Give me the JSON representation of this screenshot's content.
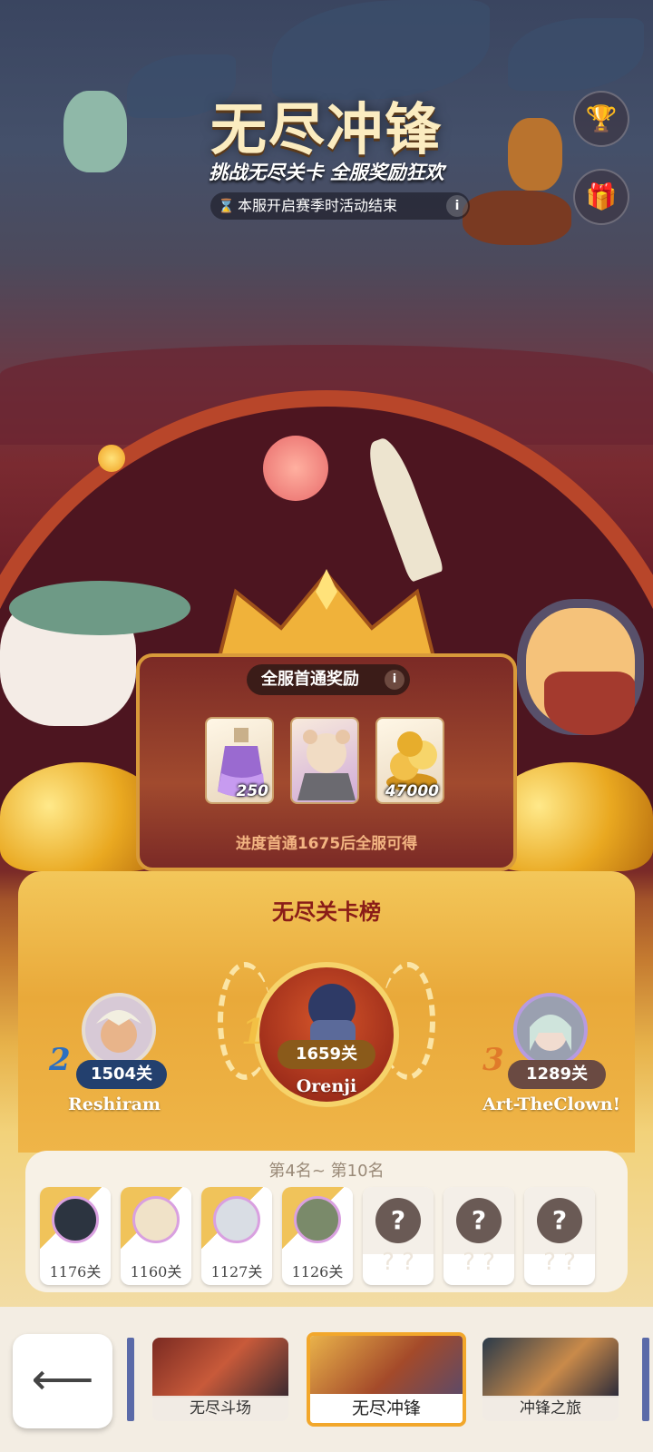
{
  "header": {
    "title": "无尽冲锋",
    "subtitle": "挑战无尽关卡 全服奖励狂欢",
    "season_note": "本服开启赛季时活动结束",
    "info_icon": "i"
  },
  "side_buttons": [
    {
      "name": "trophy-icon",
      "glyph": "🏆"
    },
    {
      "name": "gift-icon",
      "glyph": "🎁"
    }
  ],
  "first_clear": {
    "title": "全服首通奖励",
    "info_icon": "i",
    "rewards": [
      {
        "item": "purple-potion",
        "amount": "250"
      },
      {
        "item": "hamster-avatar",
        "amount": ""
      },
      {
        "item": "gold-coins",
        "amount": "47000"
      }
    ],
    "unlock_text": "进度首通1675后全服可得"
  },
  "leaderboard": {
    "title": "无尽关卡榜",
    "top3": [
      {
        "rank": "1",
        "score": "1659关",
        "name": "Orenji"
      },
      {
        "rank": "2",
        "score": "1504关",
        "name": "Reshiram"
      },
      {
        "rank": "3",
        "score": "1289关",
        "name": "Art-TheClown!"
      }
    ],
    "lower_title": "第4名~ 第10名",
    "lower": [
      {
        "score": "1176关",
        "locked": false
      },
      {
        "score": "1160关",
        "locked": false
      },
      {
        "score": "1127关",
        "locked": false
      },
      {
        "score": "1126关",
        "locked": false
      },
      {
        "score": "",
        "locked": true
      },
      {
        "score": "",
        "locked": true
      },
      {
        "score": "",
        "locked": true
      }
    ],
    "locked_glyph": "?"
  },
  "nav": {
    "back_glyph": "⟵",
    "tabs": [
      {
        "label": "无尽斗场",
        "active": false
      },
      {
        "label": "无尽冲锋",
        "active": true
      },
      {
        "label": "冲锋之旅",
        "active": false
      }
    ]
  },
  "colors": {
    "accent_gold": "#f2a72b",
    "title_red": "#8a1d18",
    "rank1_pill": "#8a5a1a",
    "rank2_pill": "#23406e",
    "rank3_pill": "#6a4a42"
  }
}
